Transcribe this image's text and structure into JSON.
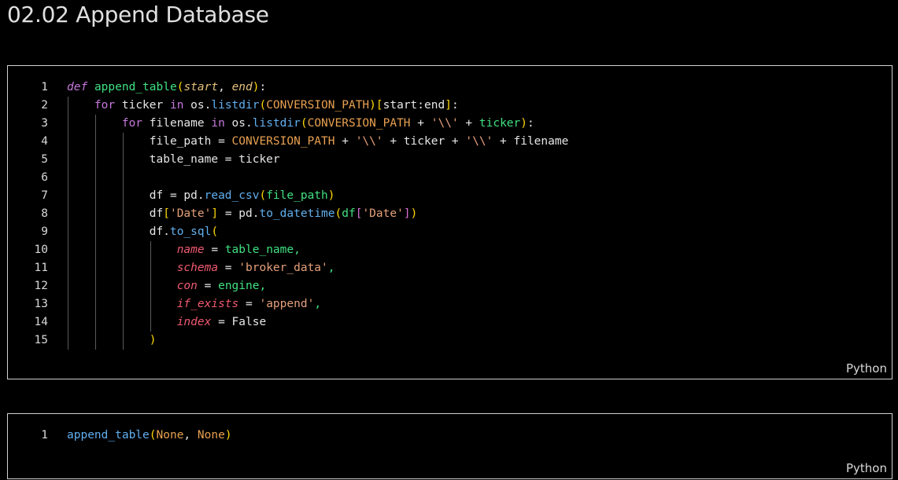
{
  "page": {
    "title": "02.02 Append Database"
  },
  "cells": [
    {
      "language": "Python",
      "lines": [
        {
          "n": "1",
          "indent": 0,
          "tokens": [
            {
              "t": "def",
              "c": "k-kw"
            },
            {
              "t": " ",
              "c": "k-var"
            },
            {
              "t": "append_table",
              "c": "k-fnname"
            },
            {
              "t": "(",
              "c": "k-br1"
            },
            {
              "t": "start",
              "c": "k-param"
            },
            {
              "t": ", ",
              "c": "k-var"
            },
            {
              "t": "end",
              "c": "k-param"
            },
            {
              "t": ")",
              "c": "k-br1"
            },
            {
              "t": ":",
              "c": "k-var"
            }
          ]
        },
        {
          "n": "2",
          "indent": 1,
          "tokens": [
            {
              "t": "for",
              "c": "k-ctrl"
            },
            {
              "t": " ticker ",
              "c": "k-var"
            },
            {
              "t": "in",
              "c": "k-ctrl"
            },
            {
              "t": " os.",
              "c": "k-var"
            },
            {
              "t": "listdir",
              "c": "k-fn"
            },
            {
              "t": "(",
              "c": "k-br1"
            },
            {
              "t": "CONVERSION_PATH",
              "c": "k-const"
            },
            {
              "t": ")",
              "c": "k-br1"
            },
            {
              "t": "[",
              "c": "k-br1"
            },
            {
              "t": "start:end",
              "c": "k-var"
            },
            {
              "t": "]",
              "c": "k-br1"
            },
            {
              "t": ":",
              "c": "k-var"
            }
          ]
        },
        {
          "n": "3",
          "indent": 2,
          "tokens": [
            {
              "t": "for",
              "c": "k-ctrl"
            },
            {
              "t": " filename ",
              "c": "k-var"
            },
            {
              "t": "in",
              "c": "k-ctrl"
            },
            {
              "t": " os.",
              "c": "k-var"
            },
            {
              "t": "listdir",
              "c": "k-fn"
            },
            {
              "t": "(",
              "c": "k-br1"
            },
            {
              "t": "CONVERSION_PATH",
              "c": "k-const"
            },
            {
              "t": " + ",
              "c": "k-var"
            },
            {
              "t": "'\\\\'",
              "c": "k-str"
            },
            {
              "t": " + ",
              "c": "k-var"
            },
            {
              "t": "ticker",
              "c": "k-green"
            },
            {
              "t": ")",
              "c": "k-br1"
            },
            {
              "t": ":",
              "c": "k-var"
            }
          ]
        },
        {
          "n": "4",
          "indent": 3,
          "tokens": [
            {
              "t": "file_path = ",
              "c": "k-var"
            },
            {
              "t": "CONVERSION_PATH",
              "c": "k-const"
            },
            {
              "t": " + ",
              "c": "k-var"
            },
            {
              "t": "'\\\\'",
              "c": "k-str"
            },
            {
              "t": " + ticker + ",
              "c": "k-var"
            },
            {
              "t": "'\\\\'",
              "c": "k-str"
            },
            {
              "t": " + filename",
              "c": "k-var"
            }
          ]
        },
        {
          "n": "5",
          "indent": 3,
          "tokens": [
            {
              "t": "table_name = ticker",
              "c": "k-var"
            }
          ]
        },
        {
          "n": "6",
          "indent": 3,
          "tokens": []
        },
        {
          "n": "7",
          "indent": 3,
          "tokens": [
            {
              "t": "df = pd.",
              "c": "k-var"
            },
            {
              "t": "read_csv",
              "c": "k-fn"
            },
            {
              "t": "(",
              "c": "k-br1"
            },
            {
              "t": "file_path",
              "c": "k-green"
            },
            {
              "t": ")",
              "c": "k-br1"
            }
          ]
        },
        {
          "n": "8",
          "indent": 3,
          "tokens": [
            {
              "t": "df",
              "c": "k-var"
            },
            {
              "t": "[",
              "c": "k-br1"
            },
            {
              "t": "'Date'",
              "c": "k-str"
            },
            {
              "t": "]",
              "c": "k-br1"
            },
            {
              "t": " = pd.",
              "c": "k-var"
            },
            {
              "t": "to_datetime",
              "c": "k-fn"
            },
            {
              "t": "(",
              "c": "k-br1"
            },
            {
              "t": "df",
              "c": "k-green"
            },
            {
              "t": "[",
              "c": "k-br2"
            },
            {
              "t": "'Date'",
              "c": "k-str"
            },
            {
              "t": "]",
              "c": "k-br2"
            },
            {
              "t": ")",
              "c": "k-br1"
            }
          ]
        },
        {
          "n": "9",
          "indent": 3,
          "tokens": [
            {
              "t": "df.",
              "c": "k-var"
            },
            {
              "t": "to_sql",
              "c": "k-fn"
            },
            {
              "t": "(",
              "c": "k-br1"
            }
          ]
        },
        {
          "n": "10",
          "indent": 4,
          "tokens": [
            {
              "t": "name",
              "c": "k-kwarg"
            },
            {
              "t": " = ",
              "c": "k-var"
            },
            {
              "t": "table_name,",
              "c": "k-green"
            }
          ]
        },
        {
          "n": "11",
          "indent": 4,
          "tokens": [
            {
              "t": "schema",
              "c": "k-kwarg"
            },
            {
              "t": " = ",
              "c": "k-var"
            },
            {
              "t": "'broker_data'",
              "c": "k-str"
            },
            {
              "t": ",",
              "c": "k-green"
            }
          ]
        },
        {
          "n": "12",
          "indent": 4,
          "tokens": [
            {
              "t": "con",
              "c": "k-kwarg"
            },
            {
              "t": " = ",
              "c": "k-var"
            },
            {
              "t": "engine,",
              "c": "k-green"
            }
          ]
        },
        {
          "n": "13",
          "indent": 4,
          "tokens": [
            {
              "t": "if_exists",
              "c": "k-kwarg"
            },
            {
              "t": " = ",
              "c": "k-var"
            },
            {
              "t": "'append'",
              "c": "k-str"
            },
            {
              "t": ",",
              "c": "k-green"
            }
          ]
        },
        {
          "n": "14",
          "indent": 4,
          "tokens": [
            {
              "t": "index",
              "c": "k-kwarg"
            },
            {
              "t": " = ",
              "c": "k-var"
            },
            {
              "t": "False",
              "c": "k-var"
            }
          ]
        },
        {
          "n": "15",
          "indent": 3,
          "tokens": [
            {
              "t": ")",
              "c": "k-br1"
            }
          ]
        }
      ]
    },
    {
      "language": "Python",
      "lines": [
        {
          "n": "1",
          "indent": 0,
          "tokens": [
            {
              "t": "append_table",
              "c": "k-fn"
            },
            {
              "t": "(",
              "c": "k-br1"
            },
            {
              "t": "None",
              "c": "k-const"
            },
            {
              "t": ", ",
              "c": "k-var"
            },
            {
              "t": "None",
              "c": "k-const"
            },
            {
              "t": ")",
              "c": "k-br1"
            }
          ]
        }
      ]
    }
  ]
}
